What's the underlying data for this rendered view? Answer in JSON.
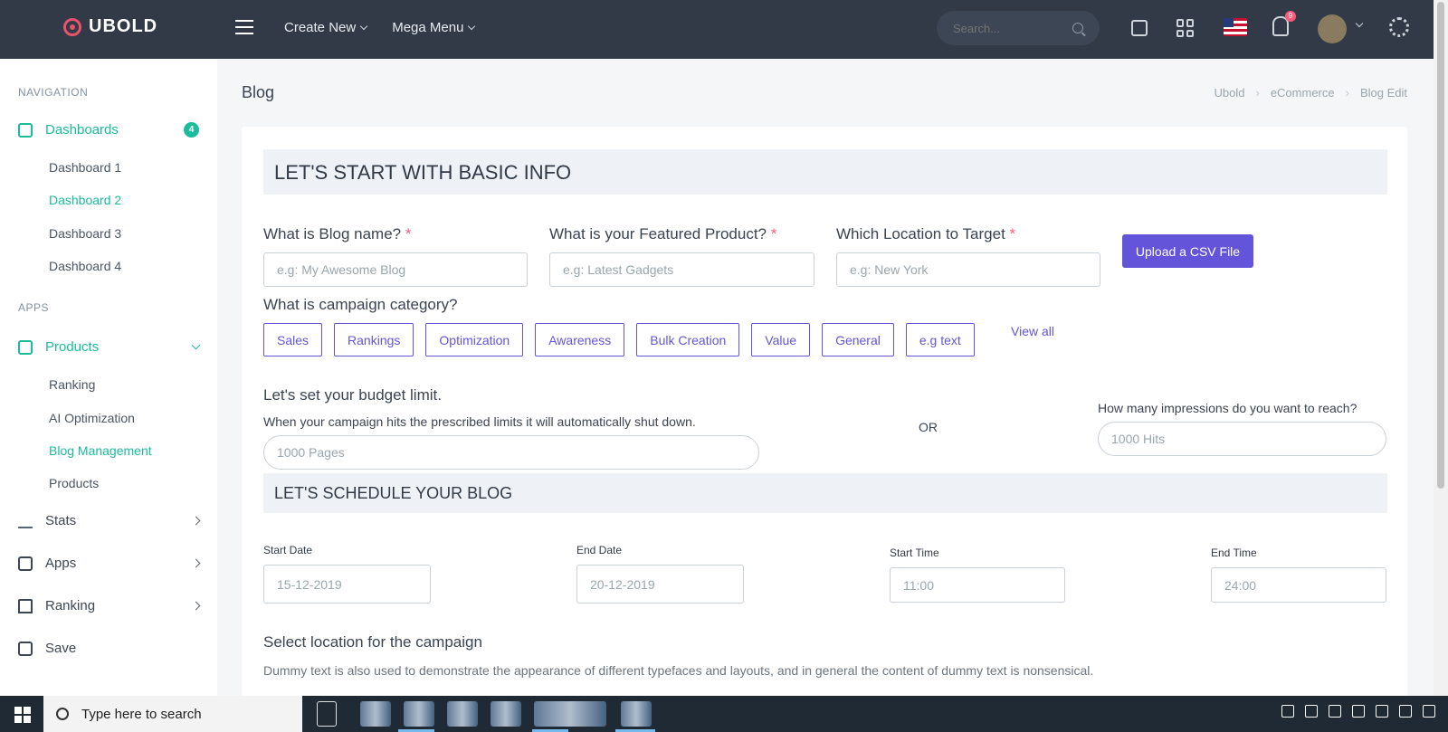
{
  "topbar": {
    "logo_text": "UBOLD",
    "nav": [
      {
        "label": "Create New"
      },
      {
        "label": "Mega Menu"
      }
    ],
    "search_placeholder": "Search...",
    "notification_count": "9"
  },
  "sidebar": {
    "navigation_title": "NAVIGATION",
    "dashboards_label": "Dashboards",
    "dashboards_count": "4",
    "dashboards": [
      "Dashboard 1",
      "Dashboard 2",
      "Dashboard 3",
      "Dashboard 4"
    ],
    "apps_title": "APPS",
    "products_label": "Products",
    "products_sub": [
      "Ranking",
      "AI Optimization",
      "Blog Management",
      "Products"
    ],
    "others": [
      "Stats",
      "Apps",
      "Ranking",
      "Save"
    ]
  },
  "page": {
    "title": "Blog",
    "breadcrumb": [
      "Ubold",
      "eCommerce",
      "Blog Edit"
    ]
  },
  "form": {
    "section1_title": "LET'S START WITH BASIC INFO",
    "q_blog_name": "What is Blog name?",
    "q_featured": "What is your Featured Product?",
    "q_location": "Which Location to Target",
    "req_mark": "*",
    "ph_blog_name": "e.g: My Awesome Blog",
    "ph_featured": "e.g: Latest Gadgets",
    "ph_location": "e.g: New York",
    "upload_button": "Upload a CSV File",
    "q_category": "What is campaign category?",
    "categories": [
      "Sales",
      "Rankings",
      "Optimization",
      "Awareness",
      "Bulk Creation",
      "Value",
      "General",
      "e.g text"
    ],
    "view_all": "View all",
    "budget_title": "Let's set your budget limit.",
    "budget_desc": "When your campaign hits the prescribed limits it will automatically shut down.",
    "ph_pages": "1000 Pages",
    "or_text": "OR",
    "impressions_q": "How many impressions do you want to reach?",
    "ph_hits": "1000 Hits",
    "section2_title": "LET'S SCHEDULE YOUR BLOG",
    "start_date_label": "Start Date",
    "start_date_value": "15-12-2019",
    "end_date_label": "End Date",
    "end_date_value": "20-12-2019",
    "start_time_label": "Start Time",
    "start_time_value": "11:00",
    "end_time_label": "End Time",
    "end_time_value": "24:00",
    "location_title": "Select location for the campaign",
    "location_hint": "Dummy text is also used to demonstrate the appearance of different typefaces and layouts, and in general the content of dummy text is nonsensical."
  },
  "taskbar": {
    "search_text": "Type here to search"
  },
  "colors": {
    "topbar": "#313a46",
    "accent": "#1abc9c",
    "primary": "#6454d9",
    "required": "#fa5c7c"
  }
}
